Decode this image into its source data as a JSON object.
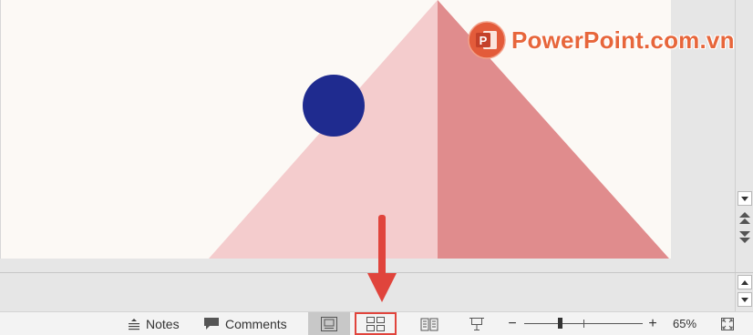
{
  "watermark": {
    "text": "PowerPoint.com.vn",
    "logo_letter": "P"
  },
  "statusbar": {
    "notes_label": "Notes",
    "comments_label": "Comments",
    "zoom_level": "65%",
    "zoom_minus": "−",
    "zoom_plus": "+"
  },
  "colors": {
    "slide_bg": "#fcf9f5",
    "triangle_light": "#f4cccd",
    "triangle_dark": "#e08c8d",
    "circle": "#1f2b8f",
    "highlight_box": "#e0443c",
    "arrow": "#e0443c",
    "watermark_text": "#e7663b"
  },
  "icons": {
    "notes": "notes-icon",
    "comments": "comment-bubble-icon",
    "normal_view": "normal-view-icon",
    "slide_sorter": "slide-sorter-icon",
    "reading_view": "reading-view-icon",
    "slideshow": "slideshow-icon",
    "fit_slide": "fit-to-window-icon"
  }
}
